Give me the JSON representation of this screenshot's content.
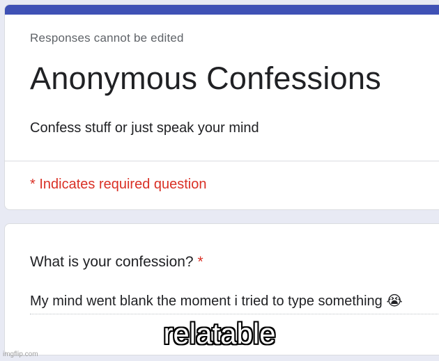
{
  "form": {
    "notice": "Responses cannot be edited",
    "title": "Anonymous Confessions",
    "description": "Confess stuff or just speak your mind",
    "required_note": "* Indicates required question",
    "accent_color": "#3f51b5",
    "required_color": "#d93025"
  },
  "question": {
    "label": "What is your confession?",
    "required_marker": "*",
    "answer": "My mind went blank the moment i tried to type something",
    "answer_emoji": "😭",
    "answer_emoji_icon": "loudly-crying-face-icon"
  },
  "meme": {
    "caption": "relatable",
    "watermark": "imgflip.com"
  }
}
